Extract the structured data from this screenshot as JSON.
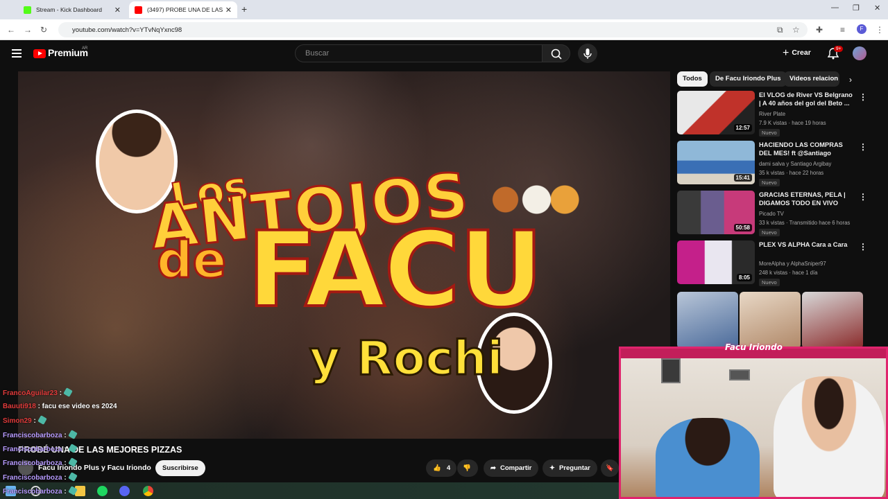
{
  "browser": {
    "tabs": [
      {
        "title": "Stream - Kick Dashboard",
        "color": "#53fc18"
      },
      {
        "title": "(3497) PROBE UNA DE LAS",
        "color": "#ff0000"
      }
    ],
    "new_tab": "+",
    "url": "youtube.com/watch?v=YTvNqYxnc98",
    "profile_initial": "F"
  },
  "youtube": {
    "logo_text": "Premium",
    "country": "AR",
    "search_placeholder": "Buscar",
    "create_label": "Crear",
    "notifications_badge": "9+"
  },
  "thumbnail_text": {
    "los": "Los",
    "antojos": "ANTOJOS",
    "de": "de",
    "facu": "FACU",
    "rochi": "y Rochi"
  },
  "player": {
    "title": "PROBÉ UNA DE LAS MEJORES PIZZAS",
    "channel": "Facu Iriondo Plus y Facu Iriondo",
    "subscribe": "Suscribirse",
    "likes": "4",
    "share": "Compartir",
    "ask": "Preguntar"
  },
  "sidebar": {
    "chips": [
      "Todos",
      "De Facu Iriondo Plus",
      "Videos relacion"
    ],
    "recommendations": [
      {
        "title": "El VLOG de River VS Belgrano | A 40 años del gol del Beto ...",
        "channel": "River Plate",
        "meta": "7.9 K vistas · hace 19 horas",
        "badge": "Nuevo",
        "duration": "12:57"
      },
      {
        "title": "HACIENDO LAS COMPRAS DEL MES! ft @Santiago Argibay | ...",
        "channel": "dami salva  y Santiago Argibay",
        "meta": "35 k vistas · hace 22 horas",
        "badge": "Nuevo",
        "duration": "15:41"
      },
      {
        "title": "GRACIAS ETERNAS, PELA | DIGAMOS TODO EN VIVO CON...",
        "channel": "Picado TV",
        "meta": "33 k vistas · Transmitido hace 6 horas",
        "badge": "Nuevo",
        "duration": "50:58"
      },
      {
        "title": "PLEX VS ALPHA Cara a Cara",
        "channel": "MoreAlpha  y AlphaSniper97",
        "meta": "248 k vistas · hace 1 día",
        "badge": "Nuevo",
        "duration": "8:05"
      }
    ]
  },
  "chat": [
    {
      "user": "FrancoAguilar23",
      "text": ":",
      "red": false
    },
    {
      "user": "Bauuti918",
      "text": ": facu ese video es 2024",
      "red": true
    },
    {
      "user": "Simon29",
      "text": ":",
      "red": false
    },
    {
      "user": "Franciscobarboza",
      "text": ":",
      "red": false
    },
    {
      "user": "Franciscobarboza",
      "text": ":",
      "red": false
    },
    {
      "user": "Franciscobarboza",
      "text": ":",
      "red": false
    },
    {
      "user": "Franciscobarboza",
      "text": ":",
      "red": false
    },
    {
      "user": "Franciscobarboza",
      "text": ":",
      "red": false
    }
  ],
  "webcam": {
    "name": "Facu Iriondo"
  }
}
